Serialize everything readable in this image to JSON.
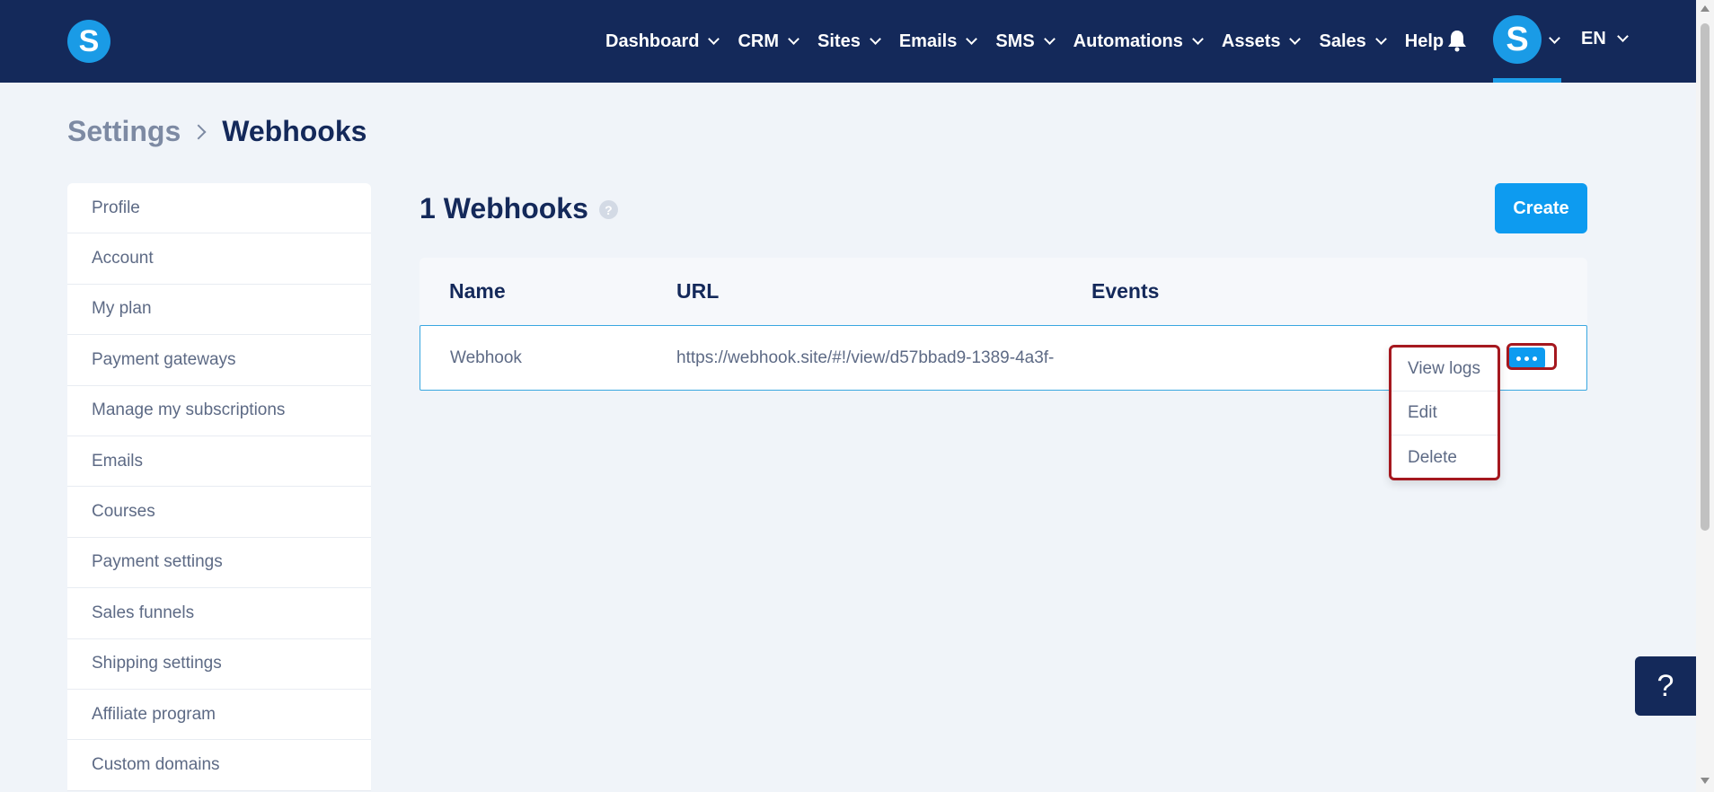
{
  "logo": {
    "letter": "S"
  },
  "nav": {
    "items": [
      {
        "label": "Dashboard",
        "has_dropdown": true
      },
      {
        "label": "CRM",
        "has_dropdown": true
      },
      {
        "label": "Sites",
        "has_dropdown": true
      },
      {
        "label": "Emails",
        "has_dropdown": true
      },
      {
        "label": "SMS",
        "has_dropdown": true
      },
      {
        "label": "Automations",
        "has_dropdown": true
      },
      {
        "label": "Assets",
        "has_dropdown": true
      },
      {
        "label": "Sales",
        "has_dropdown": true
      },
      {
        "label": "Help",
        "has_dropdown": false
      }
    ],
    "notification_icon": "bell-icon",
    "avatar_letter": "S",
    "language": "EN"
  },
  "breadcrumb": {
    "parent": "Settings",
    "current": "Webhooks"
  },
  "sidebar": {
    "items": [
      {
        "label": "Profile"
      },
      {
        "label": "Account"
      },
      {
        "label": "My plan"
      },
      {
        "label": "Payment gateways"
      },
      {
        "label": "Manage my subscriptions"
      },
      {
        "label": "Emails"
      },
      {
        "label": "Courses"
      },
      {
        "label": "Payment settings"
      },
      {
        "label": "Sales funnels"
      },
      {
        "label": "Shipping settings"
      },
      {
        "label": "Affiliate program"
      },
      {
        "label": "Custom domains"
      }
    ]
  },
  "main": {
    "title": "1 Webhooks",
    "help_icon": "?",
    "create_label": "Create",
    "table": {
      "columns": [
        "Name",
        "URL",
        "Events"
      ],
      "rows": [
        {
          "name": "Webhook",
          "url": "https://webhook.site/#!/view/d57bbad9-1389-4a3f-",
          "events": ""
        }
      ]
    },
    "row_menu": {
      "items": [
        "View logs",
        "Edit",
        "Delete"
      ]
    }
  },
  "help_fab": {
    "label": "?"
  },
  "colors": {
    "navbar": "#14295a",
    "accent": "#0d9bf0",
    "highlight": "#a5181f",
    "background": "#f0f4f9"
  }
}
